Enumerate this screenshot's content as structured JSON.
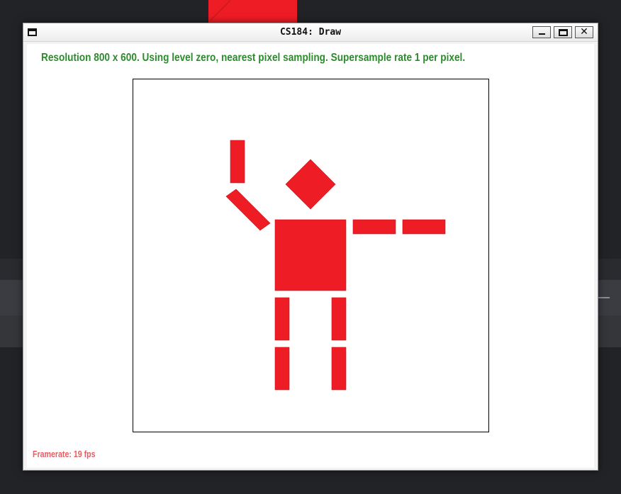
{
  "window": {
    "title": "CS184: Draw",
    "buttons": {
      "minimize": "minimize",
      "maximize": "maximize",
      "close": "✕"
    }
  },
  "status": {
    "info": "Resolution 800 x 600. Using level zero, nearest pixel sampling. Supersample rate 1 per pixel.",
    "framerate": "Framerate: 19 fps"
  },
  "drawing": {
    "fill_color": "#ee1c25",
    "shapes": [
      "head",
      "torso",
      "raised-forearm",
      "raised-upper-arm",
      "outstretched-arm-inner",
      "outstretched-arm-outer",
      "left-thigh",
      "left-shin",
      "right-thigh",
      "right-shin"
    ]
  },
  "colors": {
    "info_text": "#2c8b2c",
    "framerate_text": "#ec5a5e",
    "figure": "#ee1c25"
  }
}
